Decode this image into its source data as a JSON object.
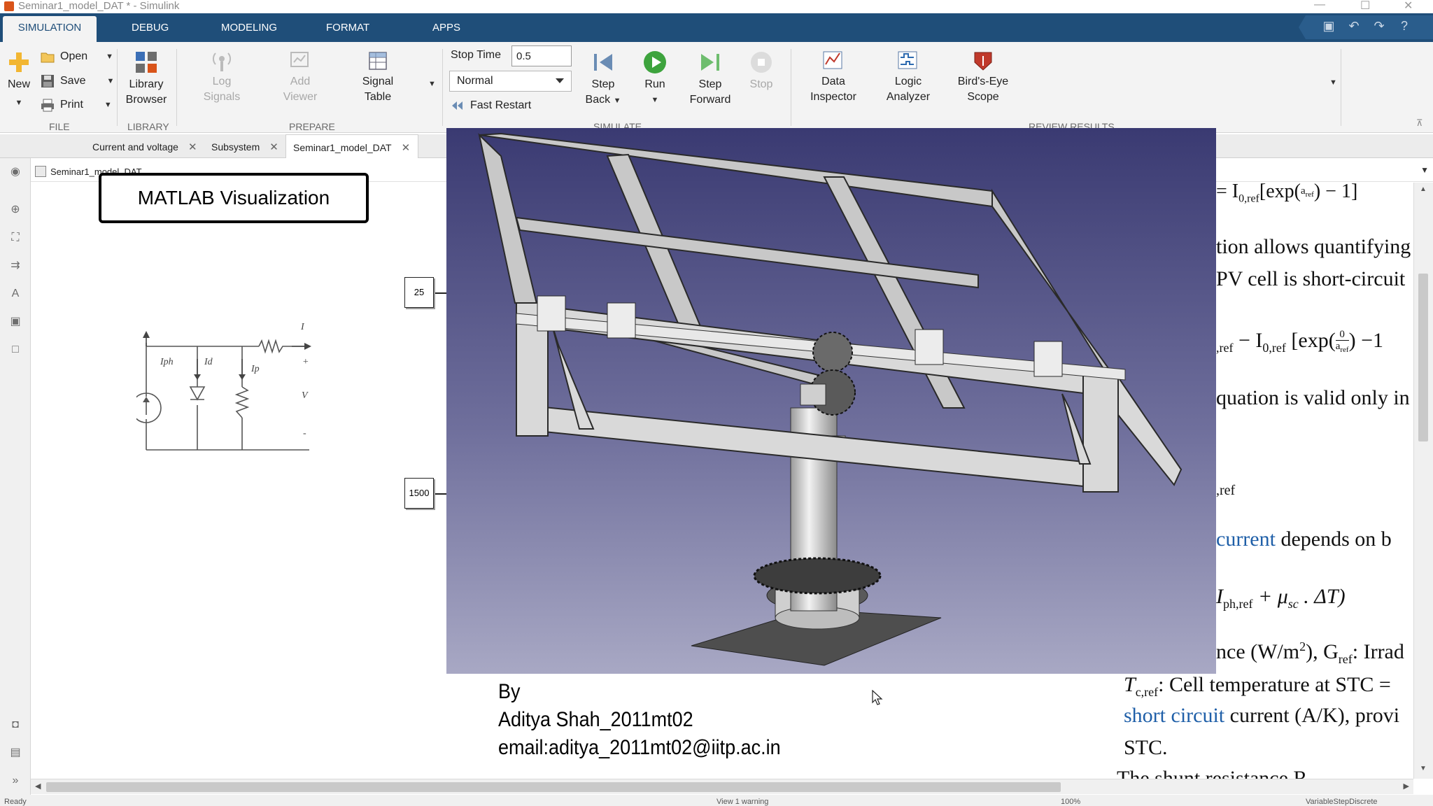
{
  "window": {
    "title": "Seminar1_model_DAT * - Simulink"
  },
  "ribbon_tabs": [
    "SIMULATION",
    "DEBUG",
    "MODELING",
    "FORMAT",
    "APPS"
  ],
  "file": {
    "new": "New",
    "open": "Open",
    "save": "Save",
    "print": "Print",
    "label": "FILE"
  },
  "library": {
    "browser_line1": "Library",
    "browser_line2": "Browser",
    "label": "LIBRARY"
  },
  "prepare": {
    "log_line1": "Log",
    "log_line2": "Signals",
    "add_line1": "Add",
    "add_line2": "Viewer",
    "signal_line1": "Signal",
    "signal_line2": "Table",
    "label": "PREPARE"
  },
  "simulate": {
    "stop_time_label": "Stop Time",
    "stop_time_value": "0.5",
    "mode": "Normal",
    "fast_restart": "Fast Restart",
    "step_back_line1": "Step",
    "step_back_line2": "Back",
    "run": "Run",
    "step_forward_line1": "Step",
    "step_forward_line2": "Forward",
    "stop": "Stop",
    "label": "SIMULATE"
  },
  "review": {
    "data_line1": "Data",
    "data_line2": "Inspector",
    "logic_line1": "Logic",
    "logic_line2": "Analyzer",
    "birds_line1": "Bird's-Eye",
    "birds_line2": "Scope",
    "label": "REVIEW RESULTS"
  },
  "editor_tabs": [
    "Current and voltage",
    "Subsystem",
    "Seminar1_model_DAT"
  ],
  "breadcrumb": "Seminar1_model_DAT",
  "canvas": {
    "visualization_label": "MATLAB Visualization",
    "const_blocks": [
      "25",
      "1500"
    ],
    "circuit": {
      "labels": [
        "I",
        "Iph",
        "Id",
        "Ip",
        "+",
        "V",
        "-"
      ]
    }
  },
  "equations": {
    "line1_pre": "= I",
    "line1_sub": "0,ref",
    "line1_post": "[exp(",
    "line1_den": "a",
    "line1_densub": "ref",
    "line1_end": ") − 1]",
    "line2": "tion allows quantifying",
    "line3": "PV cell is short-circuit",
    "line4_a": ",ref",
    "line4_b": "− I",
    "line4_sub": "0,ref",
    "line4_c": "[exp(",
    "line4_num": "0",
    "line4_den": "a",
    "line4_densub": "ref",
    "line4_d": ") −1",
    "line5": "quation is valid only in",
    "line6": ",ref",
    "line7_blue": "current",
    "line7_rest": "depends on b",
    "line8_a": "I",
    "line8_sub": "ph,ref",
    "line8_b": "+ μ",
    "line8_sub2": "sc",
    "line8_c": ". ΔT)",
    "line9_a": "nce (W/m",
    "line9_sup": "2",
    "line9_b": "), G",
    "line9_sub": "ref",
    "line9_c": ": Irrad",
    "line10_a": "T",
    "line10_sub": "c,ref",
    "line10_b": ": Cell temperature at STC =",
    "line11_blue": "short circuit",
    "line11_rest": "current (A/K), provi",
    "line12": "STC.",
    "line13": "The shunt resistance R"
  },
  "author": {
    "by": "By",
    "name": "Aditya Shah_2011mt02",
    "email": "email:aditya_2011mt02@iitp.ac.in"
  },
  "statusbar": {
    "left": "Ready",
    "center": "View 1 warning",
    "zoom": "100%",
    "right": "VariableStepDiscrete"
  }
}
